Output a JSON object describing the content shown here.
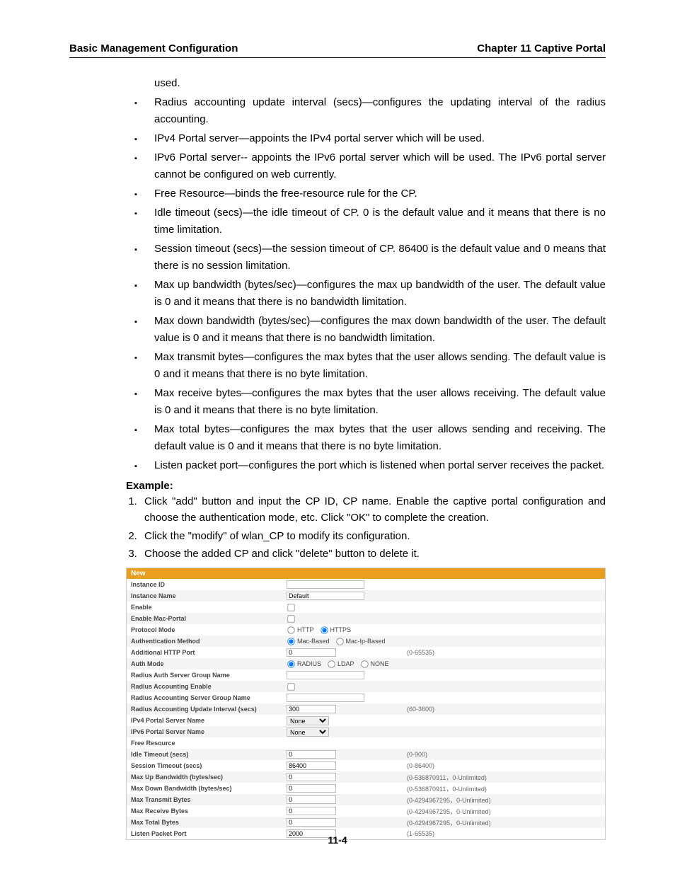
{
  "header": {
    "left": "Basic Management Configuration",
    "right": "Chapter 11 Captive Portal"
  },
  "bullets": [
    "used.",
    "Radius accounting update interval (secs)—configures the updating interval of the radius accounting.",
    "IPv4 Portal server—appoints the IPv4 portal server which will be used.",
    "IPv6 Portal server-- appoints the IPv6 portal server which will be used. The IPv6 portal server cannot be configured on web currently.",
    "Free Resource—binds the free-resource rule for the CP.",
    "Idle timeout (secs)—the idle timeout of CP. 0 is the default value and it means that there is no time limitation.",
    "Session timeout (secs)—the session timeout of CP. 86400 is the default value and 0 means that there is no session limitation.",
    "Max up bandwidth (bytes/sec)—configures the max up bandwidth of the user. The default value is 0 and it means that there is no bandwidth limitation.",
    "Max down bandwidth (bytes/sec)—configures the max down bandwidth of the user. The default value is 0 and it means that there is no bandwidth limitation.",
    "Max transmit bytes—configures the max bytes that the user allows sending. The default value is 0 and it means that there is no byte limitation.",
    "Max receive bytes—configures the max bytes that the user allows receiving. The default value is 0 and it means that there is no byte limitation.",
    "Max total bytes—configures the max bytes that the user allows sending and receiving. The default value is 0 and it means that there is no byte limitation.",
    "Listen packet port—configures the port which is listened when portal server receives the packet."
  ],
  "example": {
    "heading": "Example:",
    "steps": [
      "Click \"add\" button and input the CP ID, CP name. Enable the captive portal configuration and choose the authentication mode, etc. Click \"OK\" to complete the creation.",
      "Click the \"modify\" of wlan_CP to modify its configuration.",
      "Choose the added CP and click \"delete\" button to delete it."
    ]
  },
  "form": {
    "title": "New",
    "rows": {
      "instance_id": {
        "label": "Instance ID",
        "value": ""
      },
      "instance_name": {
        "label": "Instance Name",
        "value": "Default"
      },
      "enable": {
        "label": "Enable"
      },
      "enable_mac": {
        "label": "Enable Mac-Portal"
      },
      "protocol": {
        "label": "Protocol Mode",
        "opts": [
          "HTTP",
          "HTTPS"
        ],
        "sel": 1
      },
      "auth": {
        "label": "Authentication Method",
        "opts": [
          "Mac-Based",
          "Mac-Ip-Based"
        ],
        "sel": 0
      },
      "http_port": {
        "label": "Additional HTTP Port",
        "value": "0",
        "hint": "(0-65535)"
      },
      "auth_mode": {
        "label": "Auth Mode",
        "opts": [
          "RADIUS",
          "LDAP",
          "NONE"
        ],
        "sel": 0
      },
      "radius_auth": {
        "label": "Radius Auth Server Group Name",
        "value": ""
      },
      "radius_acct_en": {
        "label": "Radius Accounting Enable"
      },
      "radius_acct_grp": {
        "label": "Radius Accounting Server Group Name",
        "value": ""
      },
      "radius_interval": {
        "label": "Radius Accounting Update Interval (secs)",
        "value": "300",
        "hint": "(60-3600)"
      },
      "ipv4": {
        "label": "IPv4 Portal Server Name",
        "value": "None"
      },
      "ipv6": {
        "label": "IPv6 Portal Server Name",
        "value": "None"
      },
      "free": {
        "label": "Free Resource"
      },
      "idle": {
        "label": "Idle Timeout (secs)",
        "value": "0",
        "hint": "(0-900)"
      },
      "session": {
        "label": "Session Timeout (secs)",
        "value": "86400",
        "hint": "(0-86400)"
      },
      "max_up": {
        "label": "Max Up Bandwidth (bytes/sec)",
        "value": "0",
        "hint": "(0-536870911，0-Unlimited)"
      },
      "max_down": {
        "label": "Max Down Bandwidth (bytes/sec)",
        "value": "0",
        "hint": "(0-536870911，0-Unlimited)"
      },
      "max_tx": {
        "label": "Max Transmit Bytes",
        "value": "0",
        "hint": "(0-4294967295，0-Unlimited)"
      },
      "max_rx": {
        "label": "Max Receive Bytes",
        "value": "0",
        "hint": "(0-4294967295，0-Unlimited)"
      },
      "max_total": {
        "label": "Max Total Bytes",
        "value": "0",
        "hint": "(0-4294967295，0-Unlimited)"
      },
      "listen": {
        "label": "Listen Packet Port",
        "value": "2000",
        "hint": "(1-65535)"
      }
    }
  },
  "footer": "11-4"
}
